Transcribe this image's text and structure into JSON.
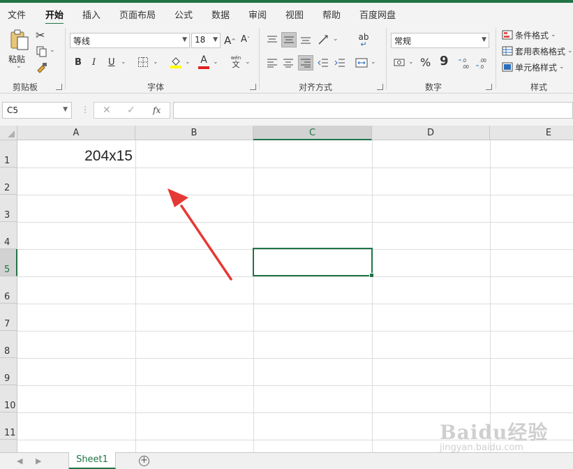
{
  "menu": {
    "tabs": [
      {
        "label": "文件"
      },
      {
        "label": "开始"
      },
      {
        "label": "插入"
      },
      {
        "label": "页面布局"
      },
      {
        "label": "公式"
      },
      {
        "label": "数据"
      },
      {
        "label": "审阅"
      },
      {
        "label": "视图"
      },
      {
        "label": "帮助"
      },
      {
        "label": "百度网盘"
      }
    ],
    "active": "开始"
  },
  "ribbon": {
    "clipboard": {
      "paste_label": "粘贴",
      "group_label": "剪贴板"
    },
    "font": {
      "font_name": "等线",
      "font_size": "18",
      "bold": "B",
      "italic": "I",
      "underline": "U",
      "increase_size": "A",
      "decrease_size": "A",
      "font_color": "A",
      "phonetic_top": "wén",
      "phonetic_bottom": "文",
      "group_label": "字体",
      "font_color_hex": "#e02020",
      "fill_color_hex": "#ffff00"
    },
    "alignment": {
      "wrap_glyph": "ab",
      "group_label": "对齐方式"
    },
    "number": {
      "format": "常规",
      "percent": "%",
      "comma": "9",
      "group_label": "数字"
    },
    "styles": {
      "conditional": "条件格式",
      "table": "套用表格格式",
      "cell": "单元格样式",
      "group_label": "样式"
    }
  },
  "formula_bar": {
    "name_box": "C5",
    "cancel": "✕",
    "enter": "✓",
    "fx": "fx",
    "value": ""
  },
  "columns": [
    "A",
    "B",
    "C",
    "D",
    "E"
  ],
  "rows": [
    "1",
    "2",
    "3",
    "4",
    "5",
    "6",
    "7",
    "8",
    "9",
    "10",
    "11"
  ],
  "cells": {
    "A1": "204x15"
  },
  "selected_cell": "C5",
  "sheets": [
    {
      "name": "Sheet1",
      "active": true
    }
  ],
  "add_sheet": "+",
  "watermark": {
    "line1": "Baidu经验",
    "line2": "jingyan.baidu.com"
  },
  "colors": {
    "accent": "#217346",
    "arrow": "#e53935"
  }
}
